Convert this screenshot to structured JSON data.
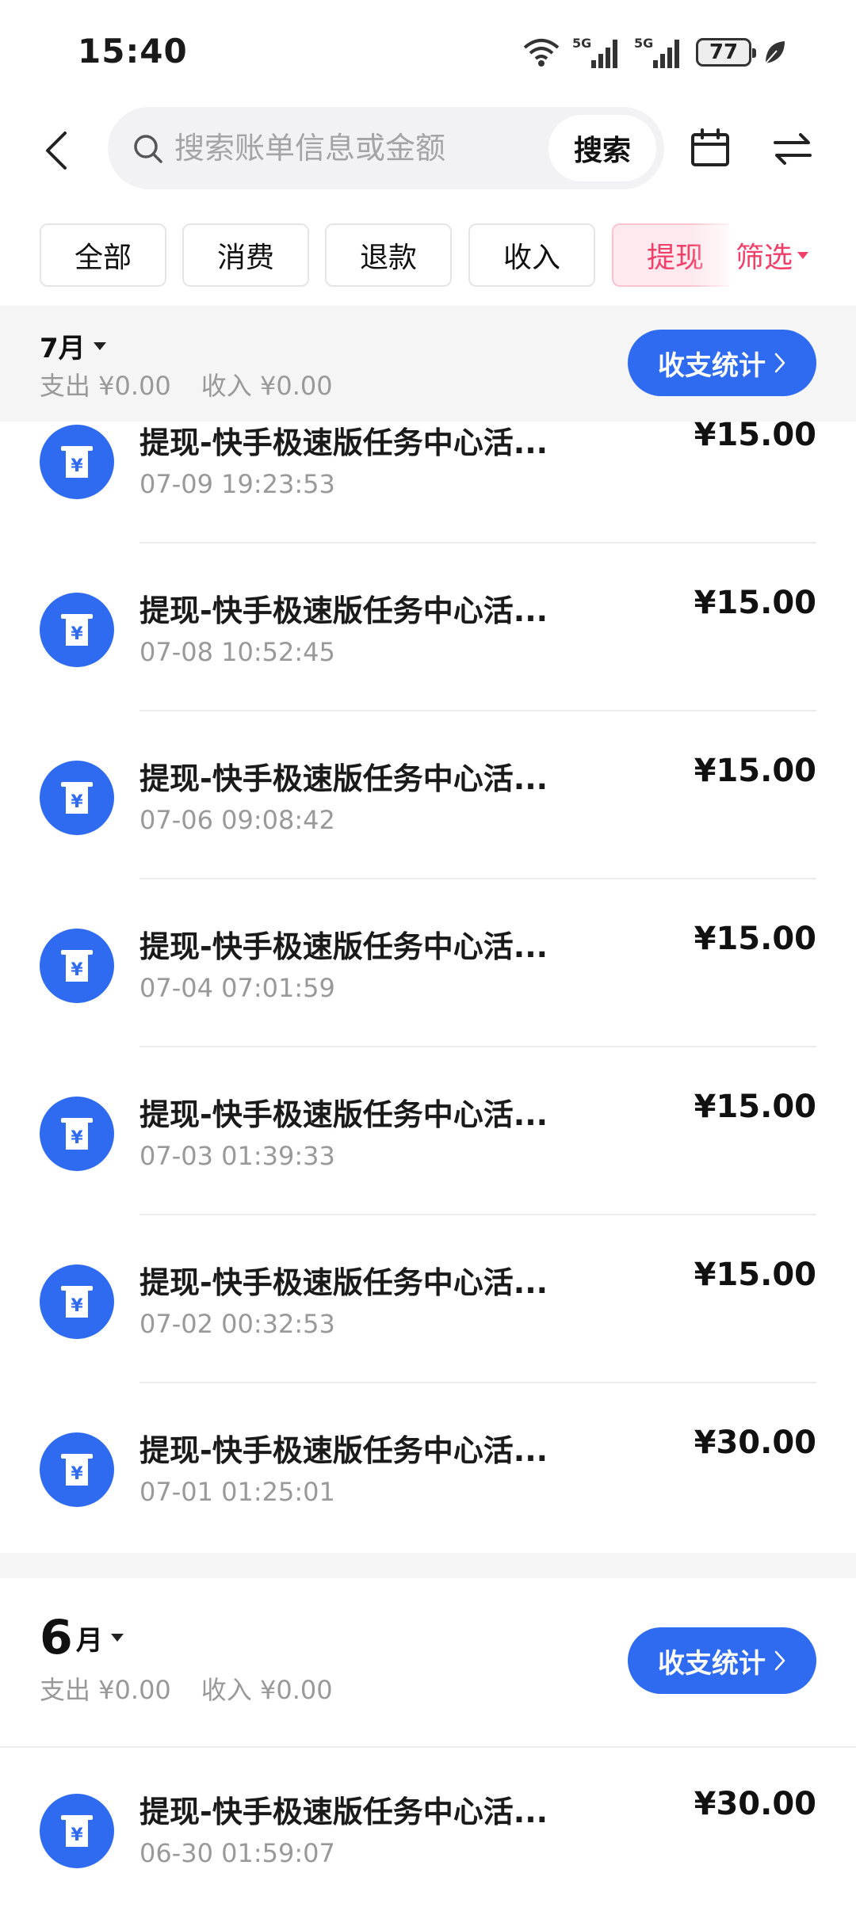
{
  "status_bar": {
    "time": "15:40",
    "battery": "77",
    "signal_label_1": "5G",
    "signal_label_2": "5G"
  },
  "header": {
    "search_placeholder": "搜索账单信息或金额",
    "search_button": "搜索",
    "icons": [
      "back-icon",
      "search-icon",
      "calendar-icon",
      "swap-icon"
    ]
  },
  "filters": {
    "tabs": [
      {
        "label": "全部",
        "active": false
      },
      {
        "label": "消费",
        "active": false
      },
      {
        "label": "退款",
        "active": false
      },
      {
        "label": "收入",
        "active": false
      },
      {
        "label": "提现",
        "active": true
      }
    ],
    "filter_button": "筛选"
  },
  "months": [
    {
      "title": "7月",
      "expense": "支出 ¥0.00",
      "income": "收入 ¥0.00",
      "stats_button": "收支统计",
      "transactions": [
        {
          "title": "提现-快手极速版任务中心活...",
          "time": "07-09 19:23:53",
          "amount": "¥15.00"
        },
        {
          "title": "提现-快手极速版任务中心活...",
          "time": "07-08 10:52:45",
          "amount": "¥15.00"
        },
        {
          "title": "提现-快手极速版任务中心活...",
          "time": "07-06 09:08:42",
          "amount": "¥15.00"
        },
        {
          "title": "提现-快手极速版任务中心活...",
          "time": "07-04 07:01:59",
          "amount": "¥15.00"
        },
        {
          "title": "提现-快手极速版任务中心活...",
          "time": "07-03 01:39:33",
          "amount": "¥15.00"
        },
        {
          "title": "提现-快手极速版任务中心活...",
          "time": "07-02 00:32:53",
          "amount": "¥15.00"
        },
        {
          "title": "提现-快手极速版任务中心活...",
          "time": "07-01 01:25:01",
          "amount": "¥30.00"
        }
      ]
    },
    {
      "title_num": "6",
      "title_unit": "月",
      "expense": "支出 ¥0.00",
      "income": "收入 ¥0.00",
      "stats_button": "收支统计",
      "transactions": [
        {
          "title": "提现-快手极速版任务中心活...",
          "time": "06-30 01:59:07",
          "amount": "¥30.00"
        }
      ]
    }
  ],
  "colors": {
    "accent_blue": "#2f6bf0",
    "accent_pink": "#f0406a"
  }
}
